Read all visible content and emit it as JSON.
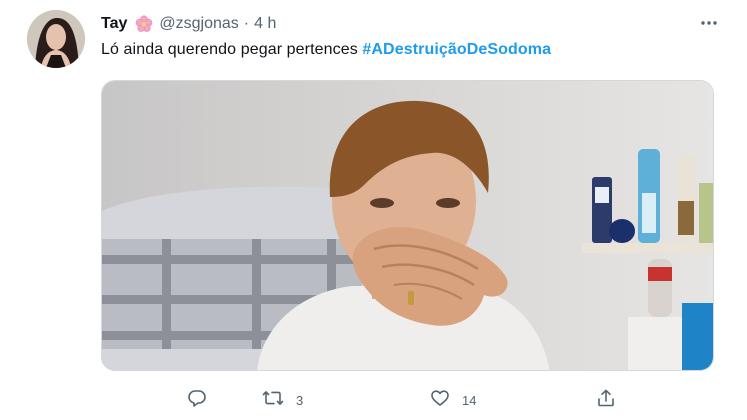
{
  "tweet": {
    "display_name": "Tay",
    "handle": "@zsgjonas",
    "separator": "·",
    "time": "4 h",
    "text": "Ló ainda querendo pegar pertences ",
    "hashtag": "#ADestruiçãoDeSodoma",
    "name_emoji": "cherry-blossom-icon"
  },
  "actions": {
    "reply_count": "",
    "retweet_count": "3",
    "like_count": "14"
  },
  "colors": {
    "text": "#0f1419",
    "secondary": "#536471",
    "link": "#1d9bf0"
  }
}
